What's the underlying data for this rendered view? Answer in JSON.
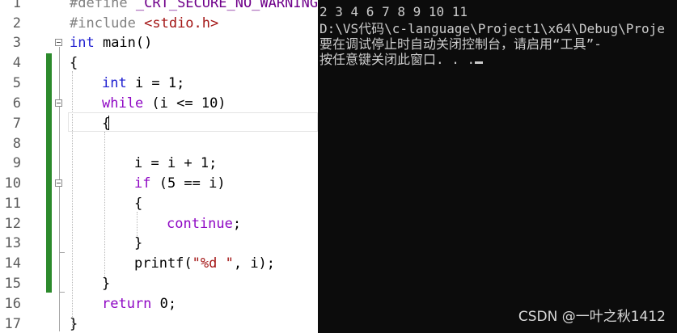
{
  "editor": {
    "line_numbers": [
      "1",
      "2",
      "3",
      "4",
      "5",
      "6",
      "7",
      "8",
      "9",
      "10",
      "11",
      "12",
      "13",
      "14",
      "15",
      "16",
      "17"
    ],
    "lines": {
      "l1": {
        "directive": "#define",
        "macro": " _CRT_SECURE_NO_WARNINGS"
      },
      "l2": {
        "directive": "#include",
        "header": " <stdio.h>"
      },
      "l3": {
        "kw": "int",
        "rest": " main()"
      },
      "l4": {
        "text": "{"
      },
      "l5": {
        "kw": "int",
        "rest": " i = 1;"
      },
      "l6": {
        "kw": "while",
        "rest": " (i <= 10)"
      },
      "l7": {
        "text": "{"
      },
      "l9": {
        "text": "i = i + 1;"
      },
      "l10": {
        "kw": "if",
        "rest": " (5 == i)"
      },
      "l11": {
        "text": "{"
      },
      "l12": {
        "kw": "continue",
        "rest": ";"
      },
      "l13": {
        "text": "}"
      },
      "l14": {
        "fn": "printf(",
        "str": "\"%d \"",
        "rest": ", i);"
      },
      "l15": {
        "text": "}"
      },
      "l16": {
        "kw": "return",
        "rest": " 0;"
      },
      "l17": {
        "text": "}"
      }
    }
  },
  "console": {
    "lines": [
      "2 3 4 6 7 8 9 10 11",
      "D:\\VS代码\\c-language\\Project1\\x64\\Debug\\Proje",
      "要在调试停止时自动关闭控制台，请启用“工具”-",
      "按任意键关闭此窗口. . ."
    ],
    "watermark": "CSDN @一叶之秋1412"
  }
}
